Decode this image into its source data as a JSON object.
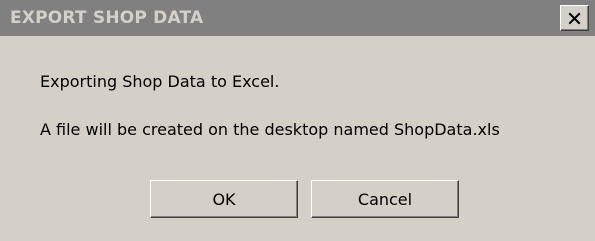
{
  "window": {
    "title": "EXPORT SHOP DATA",
    "close_label": "X",
    "close_icon": "close-icon"
  },
  "message": {
    "line1": "Exporting Shop Data to Excel.",
    "line2": "A file will be created on the desktop named ShopData.xls"
  },
  "buttons": {
    "ok_label": "OK",
    "cancel_label": "Cancel"
  },
  "colors": {
    "dialog_face": "#d4d0c8",
    "titlebar_inactive": "#808080",
    "title_text": "#d4d0c8"
  }
}
